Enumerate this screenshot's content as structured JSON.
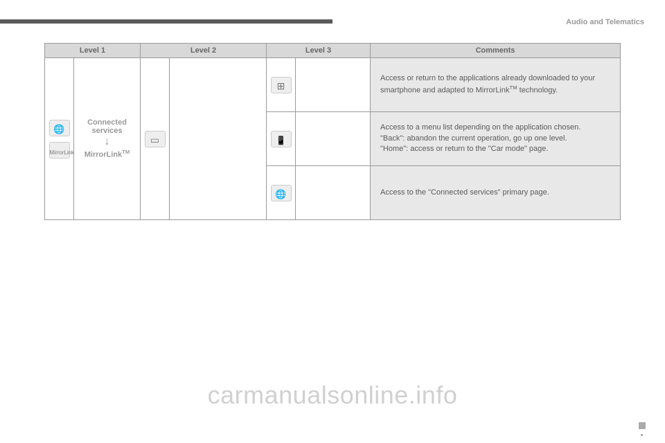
{
  "header": {
    "section": "Audio and Telematics"
  },
  "table": {
    "headers": {
      "l1": "Level 1",
      "l2": "Level 2",
      "l3": "Level 3",
      "comments": "Comments"
    },
    "level1": {
      "title": "Connected services",
      "subtitle": "MirrorLink™",
      "mirrorlink_badge": "MirrorLink"
    },
    "rows": [
      {
        "comment": "Access or return to the applications already downloaded to your smartphone and adapted to MirrorLink™ technology."
      },
      {
        "comment": "Access to a menu list depending on the application chosen.\n\"Back\": abandon the current operation, go up one level.\n\"Home\": access or return to the \"Car mode\" page."
      },
      {
        "comment": "Access to the \"Connected services\" primary page."
      }
    ]
  },
  "watermark": "carmanualsonline.info"
}
